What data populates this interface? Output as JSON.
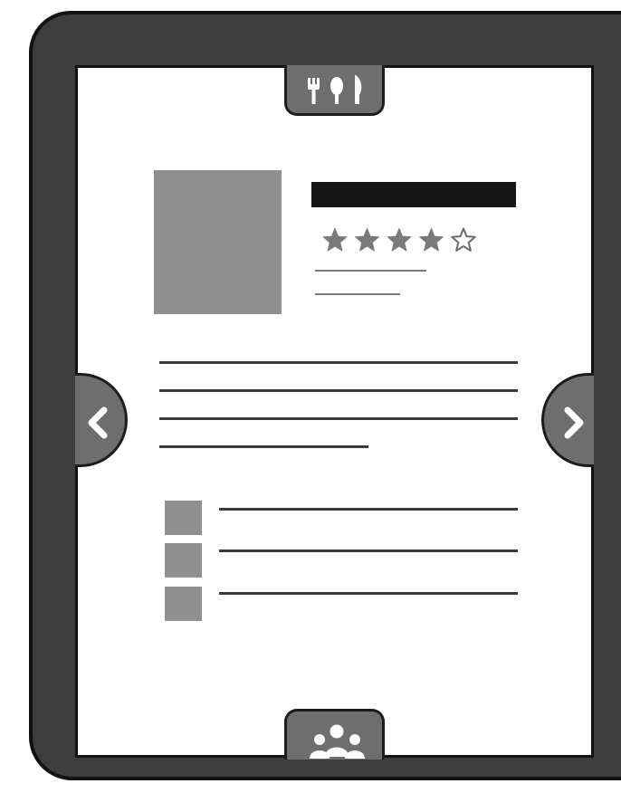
{
  "wireframe": {
    "top_tab": {
      "icon": "utensils-icon"
    },
    "bottom_tab": {
      "icon": "people-group-icon"
    },
    "prev_button": {
      "icon": "chevron-left-icon"
    },
    "next_button": {
      "icon": "chevron-right-icon"
    },
    "rating": {
      "filled": 4,
      "max": 5
    },
    "colors": {
      "frame": "#3d3d3d",
      "screen": "#ffffff",
      "placeholder": "#8f8f8f",
      "tab": "#6e6e6e",
      "title_bar": "#161616"
    }
  }
}
